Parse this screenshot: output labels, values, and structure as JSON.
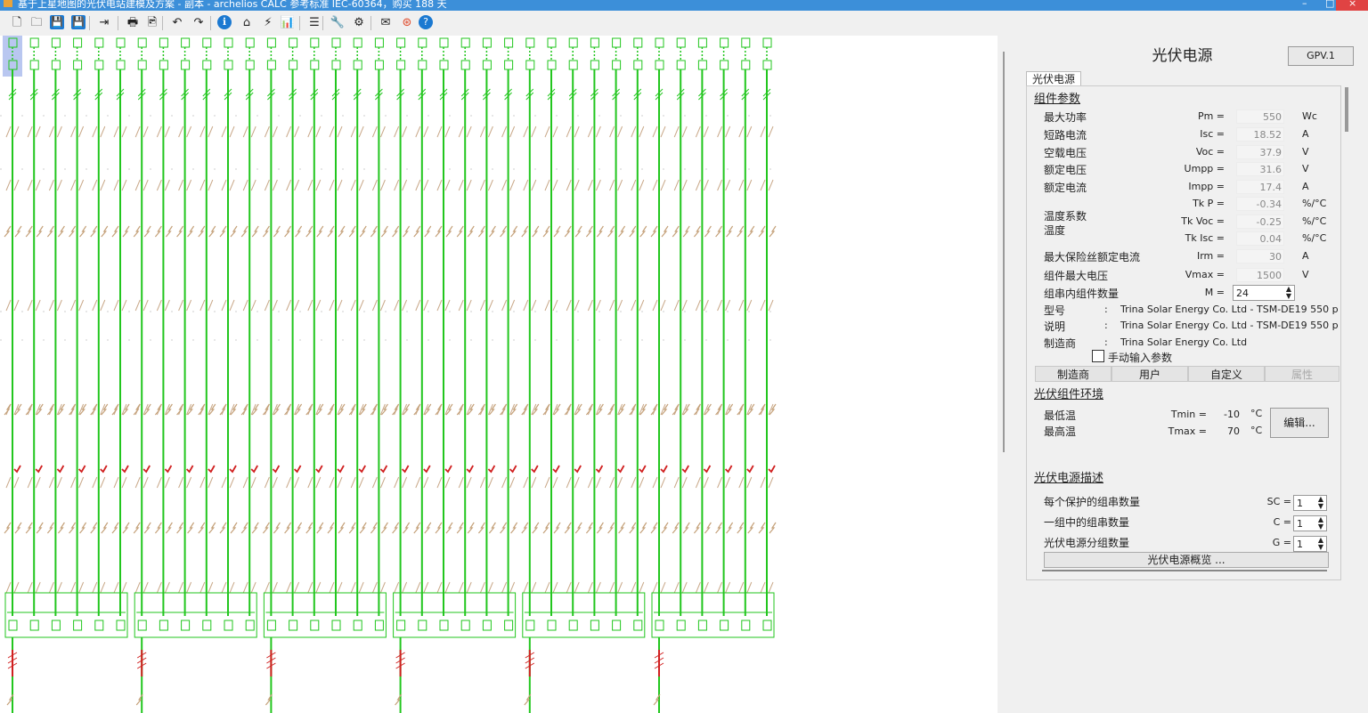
{
  "window": {
    "title": "基于上星地图的光伏电站建模及方案 - 副本 - archelios CALC 参考标准 IEC-60364，购买 188 天",
    "controls": [
      "–",
      "□",
      "×"
    ]
  },
  "toolbar": {
    "buttons": [
      {
        "name": "new-icon",
        "glyph": "🗋"
      },
      {
        "name": "open-icon",
        "glyph": "🗀"
      },
      {
        "name": "save-icon",
        "glyph": "💾"
      },
      {
        "name": "save-as-icon",
        "glyph": "💾"
      },
      {
        "name": "export-icon",
        "glyph": "⇥"
      },
      {
        "name": "print-icon",
        "glyph": "🖶"
      },
      {
        "name": "print-preview-icon",
        "glyph": "🖻"
      },
      {
        "name": "undo-icon",
        "glyph": "↶"
      },
      {
        "name": "redo-icon",
        "glyph": "↷"
      },
      {
        "name": "info-icon",
        "glyph": "ℹ"
      },
      {
        "name": "home-icon",
        "glyph": "⌂"
      },
      {
        "name": "lightning-icon",
        "glyph": "⚡"
      },
      {
        "name": "chart-icon",
        "glyph": "📊"
      },
      {
        "name": "database-icon",
        "glyph": "☰"
      },
      {
        "name": "wrench-icon",
        "glyph": "🔧"
      },
      {
        "name": "gear-icon",
        "glyph": "⚙"
      },
      {
        "name": "mail-icon",
        "glyph": "✉"
      },
      {
        "name": "lifebuoy-icon",
        "glyph": "⊛"
      },
      {
        "name": "help-icon",
        "glyph": "?"
      }
    ]
  },
  "schematic": {
    "columns": 36,
    "inverter_groups": 6,
    "colors": {
      "wire": "#22c61e",
      "fuse": "#d02020",
      "surge": "#c9a98a",
      "panel_bg": "#ffffff"
    }
  },
  "panel": {
    "title": "光伏电源",
    "id_button": "GPV.1",
    "tab": "光伏电源",
    "module_section": {
      "title": "组件参数",
      "rows": [
        {
          "label": "最大功率",
          "sym": "Pm =",
          "value": "550",
          "unit": "Wc"
        },
        {
          "label": "短路电流",
          "sym": "Isc =",
          "value": "18.52",
          "unit": "A"
        },
        {
          "label": "空载电压",
          "sym": "Voc =",
          "value": "37.9",
          "unit": "V"
        },
        {
          "label": "额定电压",
          "sym": "Umpp =",
          "value": "31.6",
          "unit": "V"
        },
        {
          "label": "额定电流",
          "sym": "Impp =",
          "value": "17.4",
          "unit": "A"
        },
        {
          "label": "",
          "sym": "Tk P =",
          "value": "-0.34",
          "unit": "%/°C"
        },
        {
          "label": "",
          "sym": "Tk Voc =",
          "value": "-0.25",
          "unit": "%/°C"
        },
        {
          "label": "",
          "sym": "Tk Isc =",
          "value": "0.04",
          "unit": "%/°C"
        },
        {
          "label": "最大保险丝额定电流",
          "sym": "Irm =",
          "value": "30",
          "unit": "A"
        },
        {
          "label": "组件最大电压",
          "sym": "Vmax =",
          "value": "1500",
          "unit": "V"
        }
      ],
      "temp_coeff_label": "温度系数",
      "temp_label": "温度",
      "modules_per_string_label": "组串内组件数量",
      "modules_per_string_sym": "M =",
      "modules_per_string_value": "24",
      "model_label": "型号",
      "model_value": "Trina Solar Energy Co. Ltd  - TSM-DE19 550 p",
      "desc_label": "说明",
      "desc_value": "Trina Solar Energy Co. Ltd  - TSM-DE19 550 p",
      "maker_label": "制造商",
      "maker_value": "Trina Solar Energy Co. Ltd",
      "manual_input_label": "手动输入参数",
      "source_buttons": [
        "制造商",
        "用户",
        "自定义",
        "属性"
      ]
    },
    "env_section": {
      "title": "光伏组件环境",
      "min_temp_label": "最低温",
      "max_temp_label": "最高温",
      "tmin_sym": "Tmin =",
      "tmin_value": "-10",
      "tmax_sym": "Tmax =",
      "tmax_value": "70",
      "unit": "°C",
      "edit_button": "编辑..."
    },
    "desc_section": {
      "title": "光伏电源描述",
      "rows": [
        {
          "label": "每个保护的组串数量",
          "sym": "SC =",
          "value": "1"
        },
        {
          "label": "一组中的组串数量",
          "sym": "C =",
          "value": "1"
        },
        {
          "label": "光伏电源分组数量",
          "sym": "G =",
          "value": "1"
        }
      ],
      "map_button": "光伏电源概览 ..."
    }
  }
}
